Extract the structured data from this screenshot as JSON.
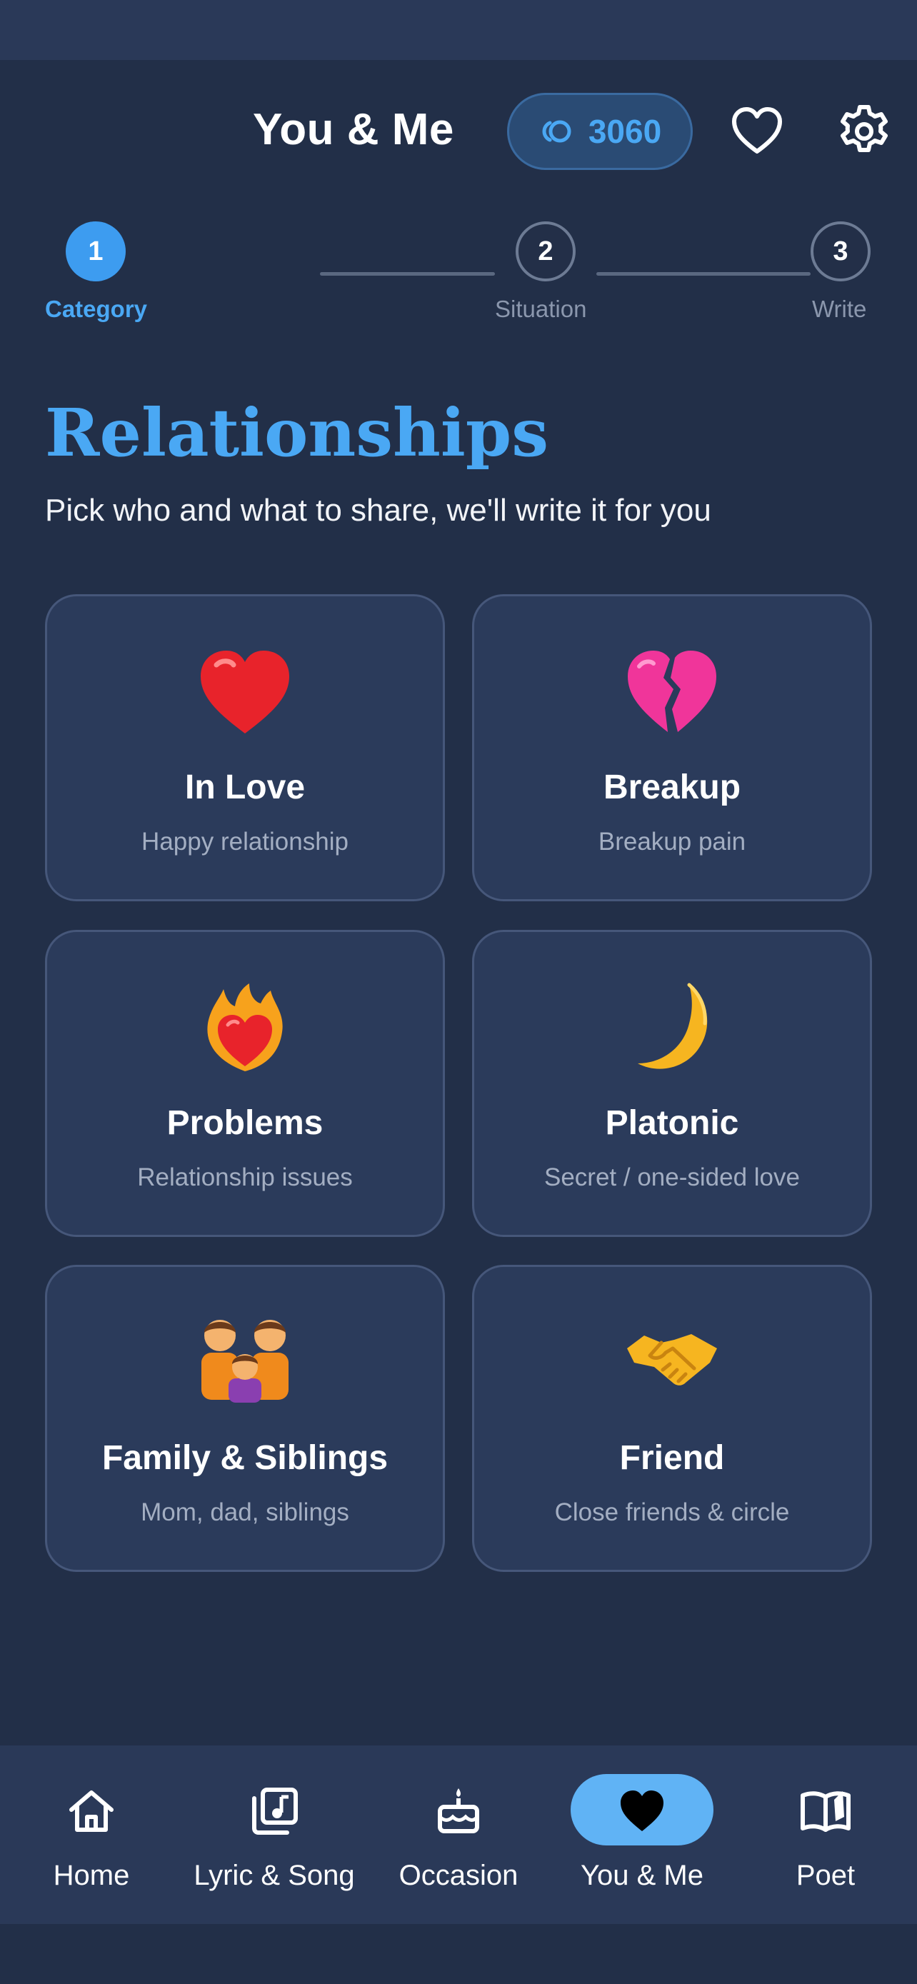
{
  "header": {
    "title": "You & Me",
    "coins": "3060"
  },
  "stepper": {
    "steps": [
      {
        "num": "1",
        "label": "Category",
        "active": true
      },
      {
        "num": "2",
        "label": "Situation",
        "active": false
      },
      {
        "num": "3",
        "label": "Write",
        "active": false
      }
    ]
  },
  "hero": {
    "title": "Relationships",
    "subtitle": "Pick who and what to share, we'll write it for you"
  },
  "cards": [
    {
      "title": "In Love",
      "subtitle": "Happy relationship",
      "icon": "red-heart-icon"
    },
    {
      "title": "Breakup",
      "subtitle": "Breakup pain",
      "icon": "broken-heart-icon"
    },
    {
      "title": "Problems",
      "subtitle": "Relationship issues",
      "icon": "heart-on-fire-icon"
    },
    {
      "title": "Platonic",
      "subtitle": "Secret / one-sided love",
      "icon": "crescent-moon-icon"
    },
    {
      "title": "Family & Siblings",
      "subtitle": "Mom, dad, siblings",
      "icon": "family-icon"
    },
    {
      "title": "Friend",
      "subtitle": "Close friends & circle",
      "icon": "handshake-icon"
    }
  ],
  "nav": {
    "items": [
      {
        "label": "Home",
        "icon": "home-icon"
      },
      {
        "label": "Lyric & Song",
        "icon": "music-library-icon"
      },
      {
        "label": "Occasion",
        "icon": "cake-icon"
      },
      {
        "label": "You & Me",
        "icon": "heart-icon",
        "active": true
      },
      {
        "label": "Poet",
        "icon": "open-book-icon"
      }
    ]
  },
  "colors": {
    "background": "#222f48",
    "card": "#2b3b5b",
    "accent": "#4aa8f4",
    "nav_active_pill": "#60b3f5"
  }
}
